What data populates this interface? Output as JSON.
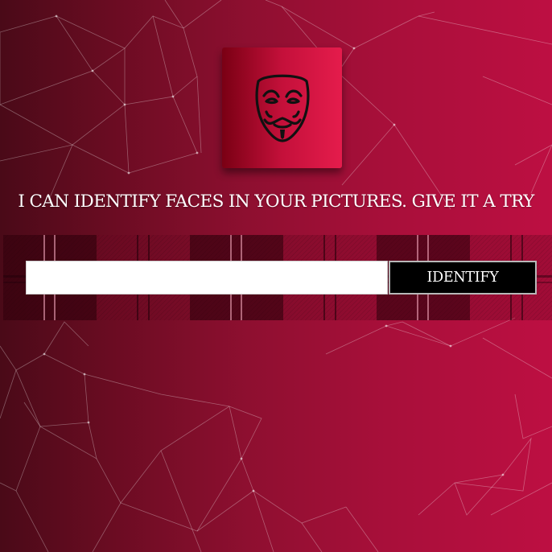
{
  "logo": {
    "icon": "guy-fawkes-mask-icon",
    "colors": {
      "gradient_start": "#7a0014",
      "gradient_end": "#e51c4c",
      "stroke": "#111111"
    }
  },
  "tagline": "I CAN IDENTIFY FACES IN YOUR PICTURES. GIVE IT A TRY",
  "form": {
    "url_input": {
      "value": "",
      "placeholder": ""
    },
    "identify_label": "IDENTIFY"
  },
  "colors": {
    "background_left": "#4a0a18",
    "background_right": "#bd0f42",
    "button_bg": "#000000",
    "text": "#ffffff"
  }
}
